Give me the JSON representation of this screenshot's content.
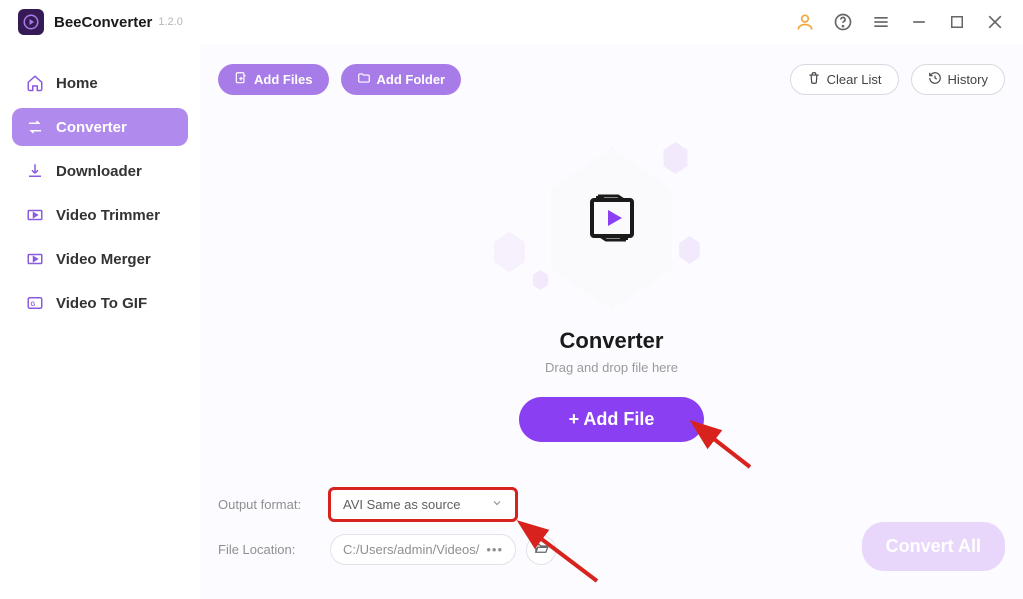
{
  "app": {
    "name": "BeeConverter",
    "version": "1.2.0"
  },
  "titlebar_icons": [
    "user-icon",
    "help-icon",
    "menu-icon",
    "minimize-icon",
    "maximize-icon",
    "close-icon"
  ],
  "sidebar": {
    "items": [
      {
        "label": "Home",
        "icon": "home-icon"
      },
      {
        "label": "Converter",
        "icon": "converter-icon",
        "active": true
      },
      {
        "label": "Downloader",
        "icon": "download-icon"
      },
      {
        "label": "Video Trimmer",
        "icon": "trimmer-icon"
      },
      {
        "label": "Video Merger",
        "icon": "merger-icon"
      },
      {
        "label": "Video To GIF",
        "icon": "gif-icon"
      }
    ]
  },
  "toolbar": {
    "add_files": "Add Files",
    "add_folder": "Add Folder",
    "clear_list": "Clear List",
    "history": "History"
  },
  "hero": {
    "title": "Converter",
    "subtitle": "Drag and drop file here",
    "add_file": "+ Add File"
  },
  "bottom": {
    "output_format_label": "Output format:",
    "output_format_value": "AVI Same as source",
    "file_location_label": "File Location:",
    "file_location_value": "C:/Users/admin/Videos/",
    "convert_all": "Convert All"
  },
  "colors": {
    "accent": "#8a3ff3",
    "accent_light": "#a87ce8",
    "red": "#d8221e"
  }
}
